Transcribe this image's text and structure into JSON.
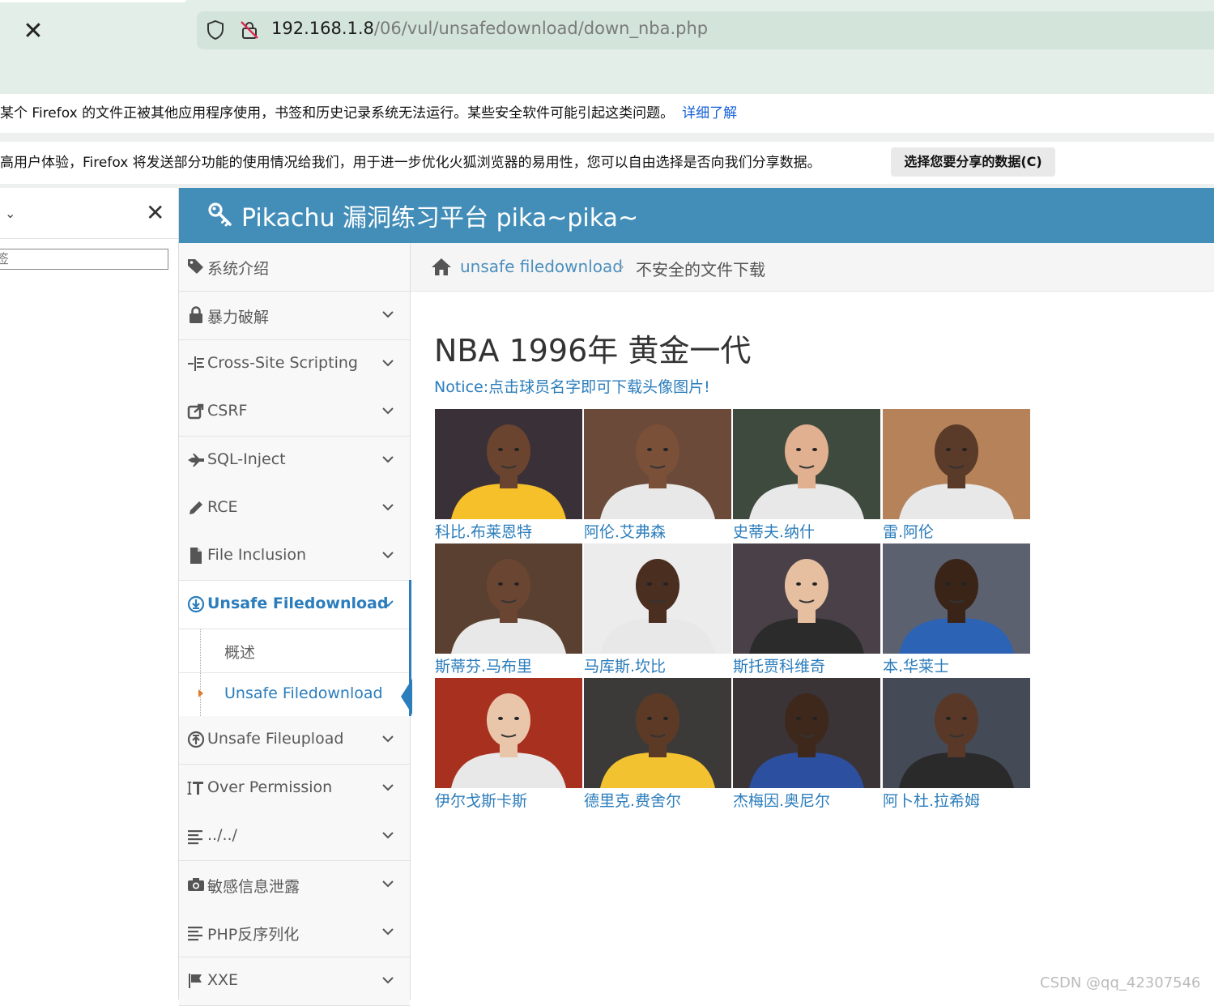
{
  "browser": {
    "url_host": "192.168.1.8",
    "url_path": "/06/vul/unsafedownload/down_nba.php",
    "notice1_text": "某个 Firefox 的文件正被其他应用程序使用，书签和历史记录系统无法运行。某些安全软件可能引起这类问题。",
    "notice1_link": "详细了解",
    "notice2_text": "高用户体验，Firefox 将发送部分功能的使用情况给我们，用于进一步优化火狐浏览器的易用性，您可以自由选择是否向我们分享数据。",
    "notice2_button": "选择您要分享的数据(C)"
  },
  "left_panel": {
    "search_placeholder": "签"
  },
  "header": {
    "title": "Pikachu 漏洞练习平台 pika~pika~"
  },
  "sidebar": {
    "items": [
      {
        "label": "系统介绍",
        "icon": "tags-icon"
      },
      {
        "label": "暴力破解",
        "icon": "lock-icon"
      },
      {
        "label": "Cross-Site Scripting",
        "icon": "indent-icon"
      },
      {
        "label": "CSRF",
        "icon": "share-icon"
      },
      {
        "label": "SQL-Inject",
        "icon": "fighter-jet-icon"
      },
      {
        "label": "RCE",
        "icon": "pencil-icon"
      },
      {
        "label": "File Inclusion",
        "icon": "file-icon"
      },
      {
        "label": "Unsafe Filedownload",
        "icon": "download-icon"
      },
      {
        "label": "Unsafe Fileupload",
        "icon": "upload-icon"
      },
      {
        "label": "Over Permission",
        "icon": "text-height-icon"
      },
      {
        "label": "../../",
        "icon": "align-left-icon"
      },
      {
        "label": "敏感信息泄露",
        "icon": "camera-icon"
      },
      {
        "label": "PHP反序列化",
        "icon": "align-left-icon"
      },
      {
        "label": "XXE",
        "icon": "flag-icon"
      }
    ],
    "sub_items": [
      {
        "label": "概述"
      },
      {
        "label": "Unsafe Filedownload"
      }
    ]
  },
  "breadcrumb": {
    "link": "unsafe filedownload",
    "current": "不安全的文件下载"
  },
  "main": {
    "title": "NBA 1996年 黄金一代",
    "notice": "Notice:点击球员名字即可下载头像图片!",
    "players": [
      {
        "name": "科比.布莱恩特",
        "jersey": "#f5c02a"
      },
      {
        "name": "阿伦.艾弗森",
        "jersey": "#e8e8e8"
      },
      {
        "name": "史蒂夫.纳什",
        "jersey": "#e8e8e8"
      },
      {
        "name": "雷.阿伦",
        "jersey": "#e8e8e8"
      },
      {
        "name": "斯蒂芬.马布里",
        "jersey": "#e8e8e8"
      },
      {
        "name": "马库斯.坎比",
        "jersey": "#e8e8e8"
      },
      {
        "name": "斯托贾科维奇",
        "jersey": "#2b2b2b"
      },
      {
        "name": "本.华莱士",
        "jersey": "#2d63b5"
      },
      {
        "name": "伊尔戈斯卡斯",
        "jersey": "#e8e8e8"
      },
      {
        "name": "德里克.费舍尔",
        "jersey": "#f2c230"
      },
      {
        "name": "杰梅因.奥尼尔",
        "jersey": "#2d4fa0"
      },
      {
        "name": "阿卜杜.拉希姆",
        "jersey": "#2a2a2a"
      }
    ]
  },
  "watermark": "CSDN @qq_42307546",
  "colors": {
    "header_bg": "#438eb9",
    "link": "#2b7dbc",
    "browser_chrome": "#e2eee7"
  }
}
